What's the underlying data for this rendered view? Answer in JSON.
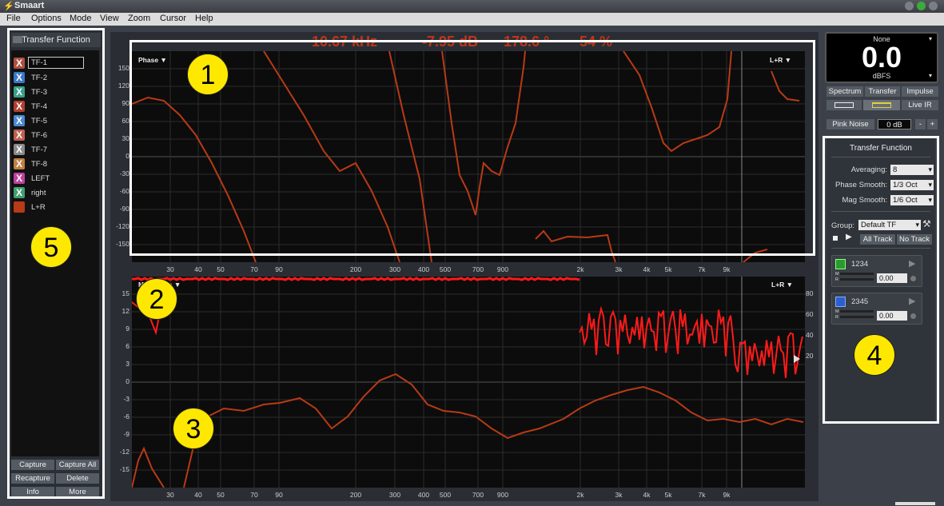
{
  "app": {
    "title": "Smaart"
  },
  "menu": [
    "File",
    "Options",
    "Mode",
    "View",
    "Zoom",
    "Cursor",
    "Help"
  ],
  "colors": {
    "trace": "#b83a16",
    "coherence": "#ff1a1a",
    "readout": "#c0341b",
    "annotation": "#ffe800"
  },
  "left_panel": {
    "header": "Transfer Function",
    "items": [
      {
        "label": "TF-1",
        "color": "#b05040",
        "icon": "X"
      },
      {
        "label": "TF-2",
        "color": "#3a78c8",
        "icon": "X"
      },
      {
        "label": "TF-3",
        "color": "#3aa08a",
        "icon": "X"
      },
      {
        "label": "TF-4",
        "color": "#b04030",
        "icon": "X"
      },
      {
        "label": "TF-5",
        "color": "#4a8ad0",
        "icon": "X"
      },
      {
        "label": "TF-6",
        "color": "#c06050",
        "icon": "X"
      },
      {
        "label": "TF-7",
        "color": "#8a8a8a",
        "icon": "X"
      },
      {
        "label": "TF-8",
        "color": "#c08040",
        "icon": "X"
      },
      {
        "label": "LEFT",
        "color": "#c040a0",
        "icon": "X"
      },
      {
        "label": "right",
        "color": "#40a070",
        "icon": "X"
      },
      {
        "label": "L+R",
        "color": "#b83a16",
        "icon": ""
      }
    ],
    "buttons": {
      "capture": "Capture",
      "capture_all": "Capture All",
      "recapture": "Recapture",
      "delete": "Delete",
      "info": "Info",
      "more": "More"
    }
  },
  "readout": {
    "freq": "10.67 kHz",
    "mag": "-7.95 dB",
    "phase": "178.6 °",
    "coh": "54 %"
  },
  "phase_graph": {
    "label": "Phase ▼",
    "channel": "L+R ▼",
    "y_ticks": [
      "150",
      "120",
      "90",
      "60",
      "30",
      "0",
      "-30",
      "-60",
      "-90",
      "-120",
      "-150"
    ],
    "x_ticks": [
      "30",
      "40",
      "50",
      "70",
      "90",
      "200",
      "300",
      "400",
      "500",
      "700",
      "900",
      "2k",
      "3k",
      "4k",
      "5k",
      "7k",
      "9k"
    ]
  },
  "mag_graph": {
    "label": "Magnitude ▼",
    "channel": "L+R ▼",
    "y_ticks": [
      "15",
      "12",
      "9",
      "6",
      "3",
      "0",
      "-3",
      "-6",
      "-9",
      "-12",
      "-15"
    ],
    "y2_ticks": [
      "80",
      "60",
      "40",
      "20"
    ],
    "x_ticks": [
      "30",
      "40",
      "50",
      "70",
      "90",
      "200",
      "300",
      "400",
      "500",
      "700",
      "900",
      "2k",
      "3k",
      "4k",
      "5k",
      "7k",
      "9k"
    ]
  },
  "right_panel": {
    "meter": {
      "source": "None",
      "value": "0.0",
      "unit": "dBFS"
    },
    "modes": [
      "Spectrum",
      "Transfer",
      "Impulse"
    ],
    "live_ir": "Live IR",
    "pink_noise": "Pink Noise",
    "pink_level": "0 dB",
    "minus": "-",
    "plus": "+",
    "tf_title": "Transfer Function",
    "averaging_label": "Averaging:",
    "averaging_value": "8",
    "phase_smooth_label": "Phase Smooth:",
    "phase_smooth_value": "1/3 Oct",
    "mag_smooth_label": "Mag Smooth:",
    "mag_smooth_value": "1/6 Oct",
    "group_label": "Group:",
    "group_value": "Default TF",
    "all_track": "All Track",
    "no_track": "No Track",
    "tracks": [
      {
        "name": "1234",
        "color": "#2a9a2a",
        "m": "M",
        "r": "R",
        "value": "0.00"
      },
      {
        "name": "2345",
        "color": "#2a60d0",
        "m": "M",
        "r": "R",
        "value": "0.00"
      }
    ]
  },
  "annotations": [
    "1",
    "2",
    "3",
    "4",
    "5"
  ]
}
